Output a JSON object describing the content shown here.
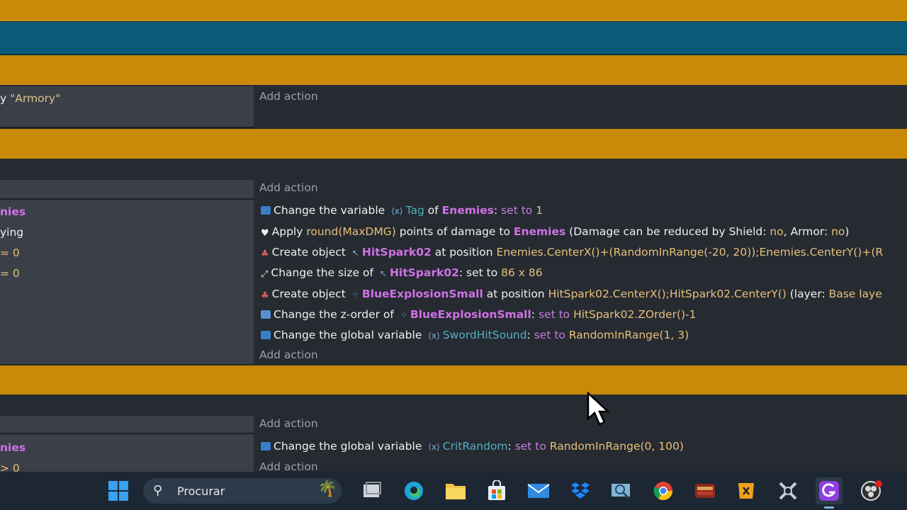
{
  "events": {
    "armory_condition": "y ",
    "armory_string": "\"Armory\"",
    "add_action": "Add action",
    "cond_enemies": "nies",
    "cond_dying": "ying",
    "cond_eq0_a": "= 0",
    "cond_eq0_b": "= 0",
    "cond_enemies2": "nies",
    "cond_gt0": "> 0"
  },
  "actions": {
    "a1": {
      "pre": "Change the variable ",
      "var": "Tag",
      "of": " of ",
      "obj": "Enemies",
      "colon": ": ",
      "set": "set to ",
      "val": "1"
    },
    "a2": {
      "pre": "Apply ",
      "expr": "round(MaxDMG)",
      "mid": " points of damage to ",
      "obj": "Enemies",
      "tail_a": " (Damage can be reduced by Shield: ",
      "v1": "no",
      "tail_b": ", Armor: ",
      "v2": "no",
      "tail_c": ")"
    },
    "a3": {
      "pre": "Create object ",
      "obj": "HitSpark02",
      "mid": " at position ",
      "pos": "Enemies.CenterX()+(RandomInRange(-20, 20));Enemies.CenterY()+(R"
    },
    "a4": {
      "pre": "Change the size of ",
      "obj": "HitSpark02",
      "colon": ": set to ",
      "val": "86 x 86"
    },
    "a5": {
      "pre": "Create object ",
      "obj": "BlueExplosionSmall",
      "mid": " at position ",
      "pos": "HitSpark02.CenterX();HitSpark02.CenterY()",
      "layer": " (layer: ",
      "layerv": "Base laye"
    },
    "a6": {
      "pre": "Change the z-order of ",
      "obj": "BlueExplosionSmall",
      "colon": ": ",
      "set": "set to ",
      "val": "HitSpark02.ZOrder()-1"
    },
    "a7": {
      "pre": "Change the global variable ",
      "var": "SwordHitSound",
      "colon": ": ",
      "set": "set to ",
      "val": "RandomInRange(1, 3)"
    },
    "a8": {
      "pre": "Change the global variable ",
      "var": "CritRandom",
      "colon": ": ",
      "set": "set to ",
      "val": "RandomInRange(0, 100)"
    }
  },
  "taskbar": {
    "search_label": "Procurar",
    "icons": [
      "windows-start-icon",
      "search-icon",
      "desktop-widget",
      "task-view-icon",
      "edge-icon",
      "file-explorer-icon",
      "store-icon",
      "mail-icon",
      "dropbox-icon",
      "screen-capture-icon",
      "chrome-icon",
      "app-icon-1",
      "app-icon-2",
      "app-icon-3",
      "gdevelop-icon",
      "obs-icon"
    ]
  },
  "colors": {
    "orange_band": "#c98a08",
    "teal_band": "#0b5b78",
    "taskbar": "#1c2733"
  }
}
